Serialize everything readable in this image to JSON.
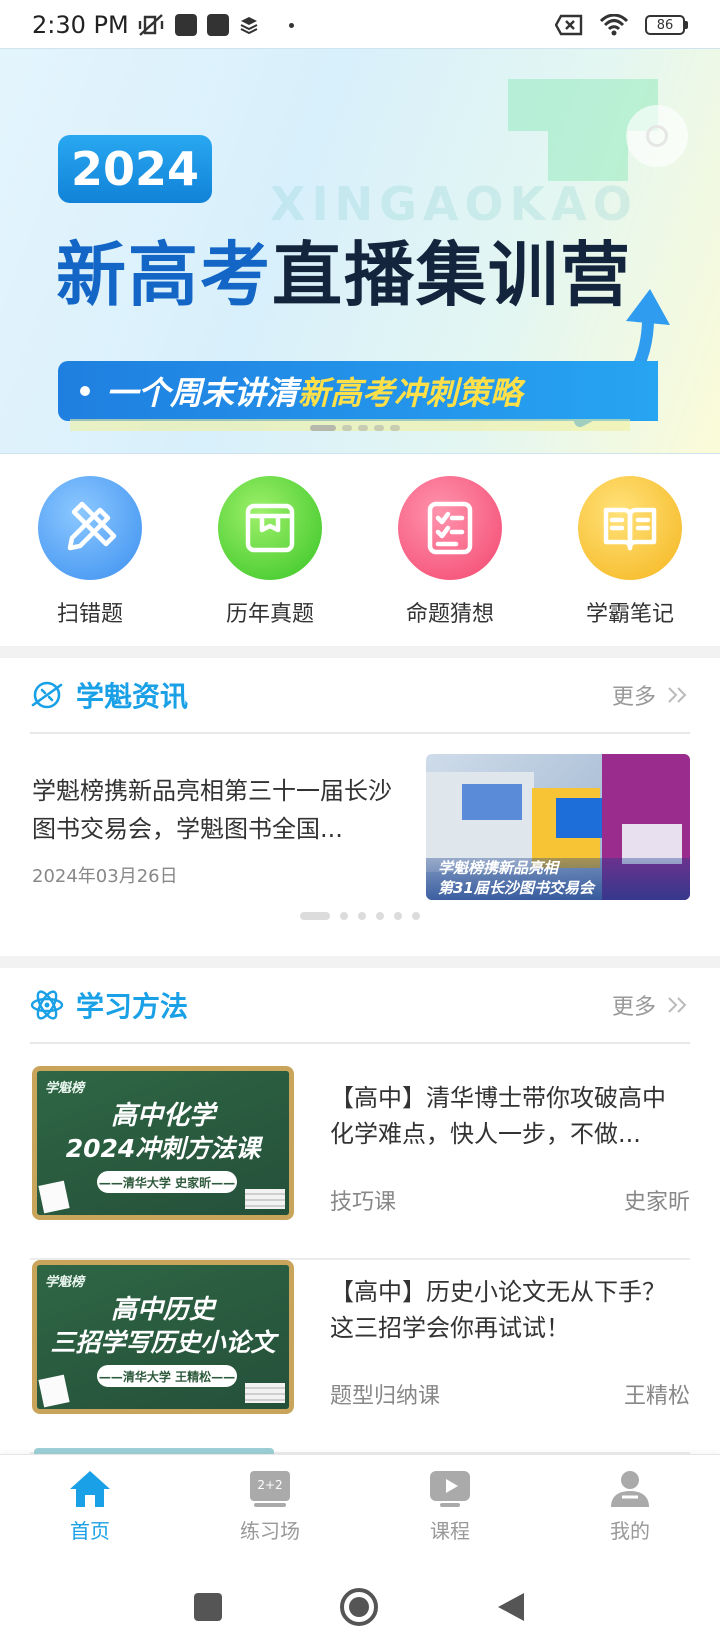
{
  "status_bar": {
    "time": "2:30 PM",
    "battery": "86"
  },
  "banner": {
    "year": "2024",
    "title_part1": "新高考",
    "title_part2": "直播集训营",
    "watermark": "XINGAOKAO",
    "strip_text": "一个周末讲清",
    "strip_highlight": "新高考冲刺策略"
  },
  "quick_menu": [
    {
      "label": "扫错题",
      "icon": "pencil-ruler-icon",
      "color": "#3b8ff0"
    },
    {
      "label": "历年真题",
      "icon": "book-box-icon",
      "color": "#36c424"
    },
    {
      "label": "命题猜想",
      "icon": "document-list-icon",
      "color": "#f3466f"
    },
    {
      "label": "学霸笔记",
      "icon": "open-book-icon",
      "color": "#f5b51d"
    }
  ],
  "news_section": {
    "title": "学魁资讯",
    "more": "更多",
    "item": {
      "title": "学魁榜携新品亮相第三十一届长沙图书交易会，学魁图书全国...",
      "date": "2024年03月26日",
      "image_caption_line1": "学魁榜携新品亮相",
      "image_caption_line2": "第31届长沙图书交易会"
    }
  },
  "method_section": {
    "title": "学习方法",
    "more": "更多",
    "courses": [
      {
        "thumb_logo": "学魁榜",
        "thumb_line1": "高中化学",
        "thumb_line2": "2024冲刺方法课",
        "thumb_pill": "——清华大学 史家昕——",
        "title": "【高中】清华博士带你攻破高中化学难点，快人一步，不做...",
        "type": "技巧课",
        "teacher": "史家昕"
      },
      {
        "thumb_logo": "学魁榜",
        "thumb_line1": "高中历史",
        "thumb_line2": "三招学写历史小论文",
        "thumb_pill": "——清华大学 王精松——",
        "title": "【高中】历史小论文无从下手？这三招学会你再试试！",
        "type": "题型归纳课",
        "teacher": "王精松"
      }
    ]
  },
  "bottom_nav": [
    {
      "label": "首页",
      "icon": "home-icon",
      "active": true
    },
    {
      "label": "练习场",
      "icon": "blackboard-icon",
      "active": false
    },
    {
      "label": "课程",
      "icon": "video-play-icon",
      "active": false
    },
    {
      "label": "我的",
      "icon": "user-icon",
      "active": false
    }
  ],
  "colors": {
    "accent": "#1aa0e6",
    "inactive": "#999999"
  }
}
